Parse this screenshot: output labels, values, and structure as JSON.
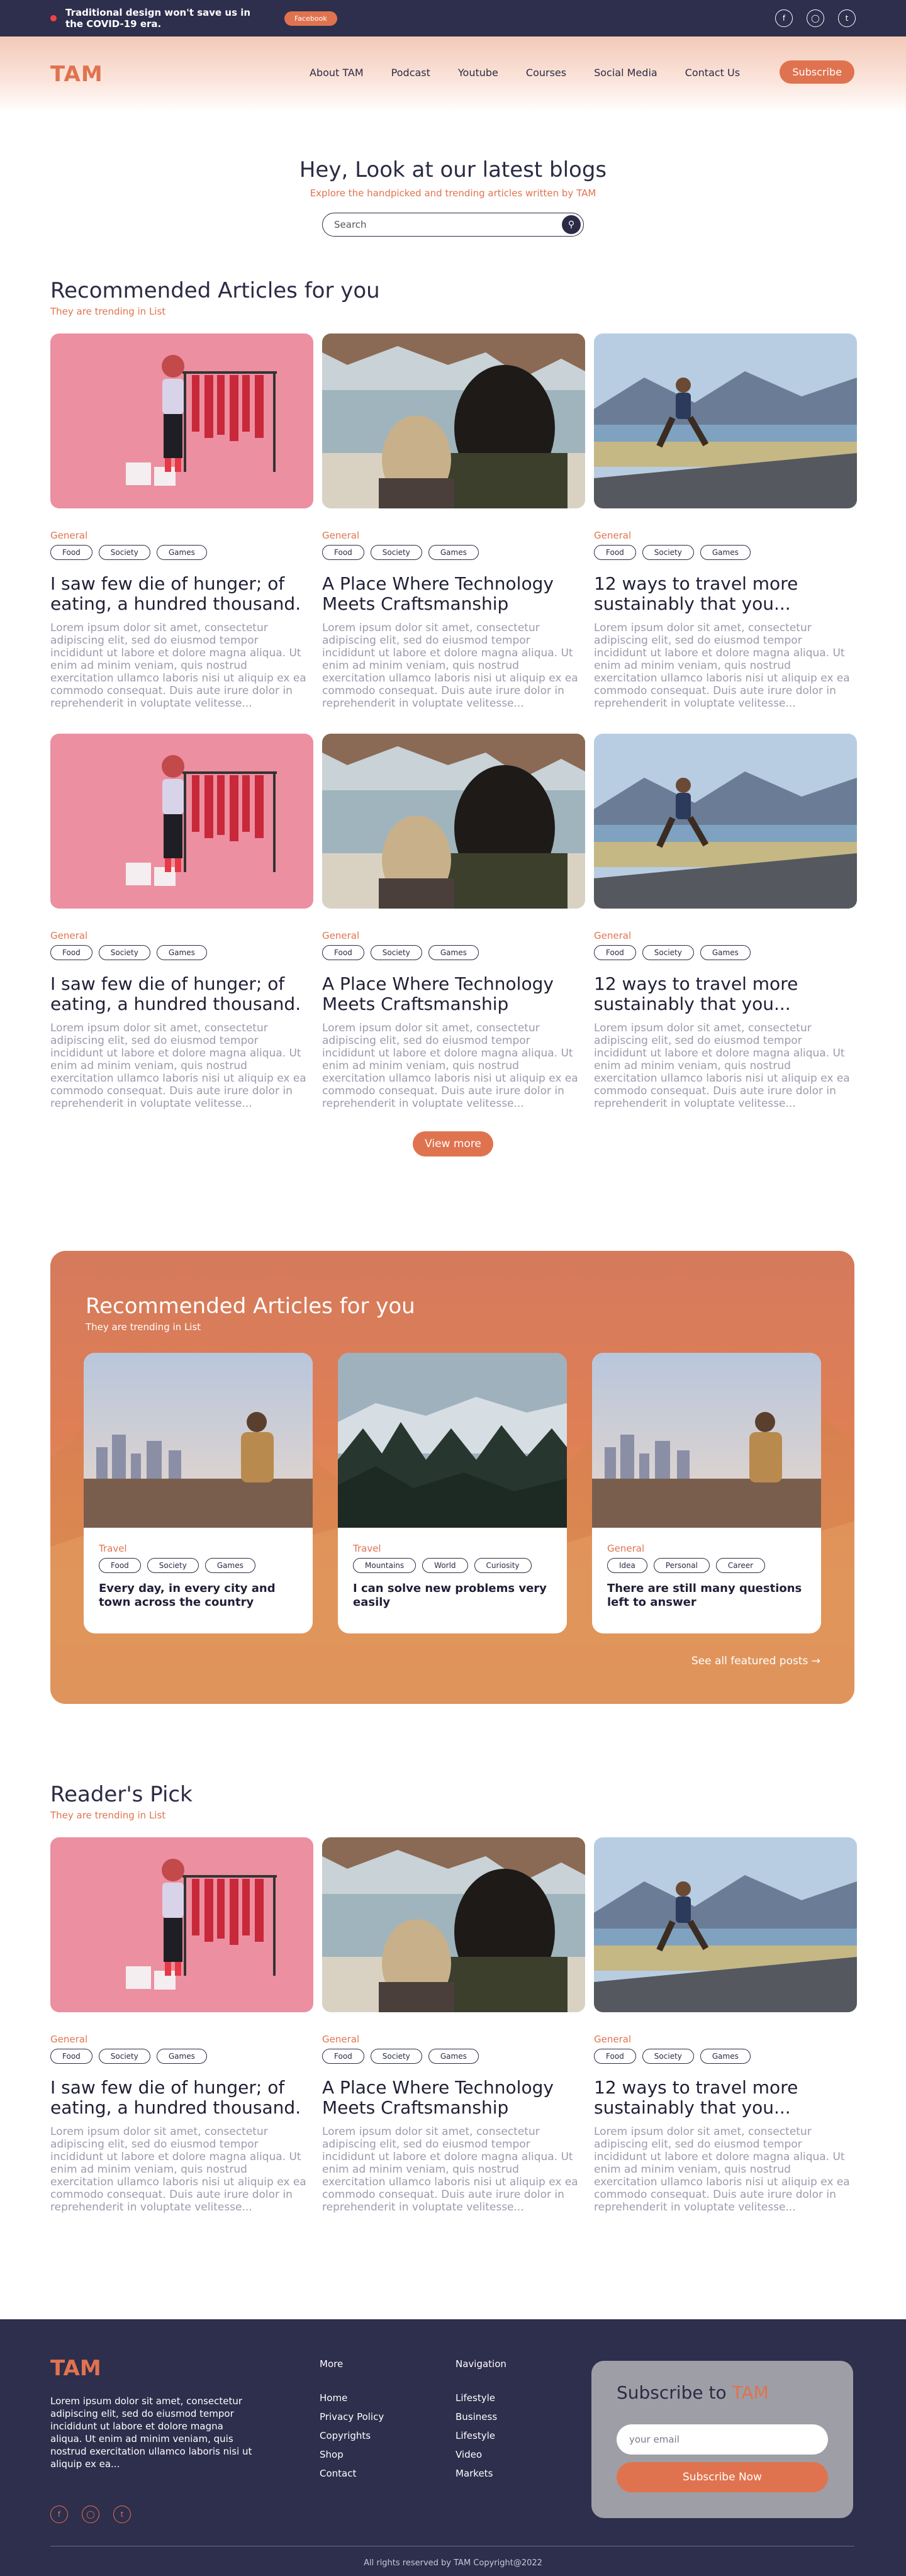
{
  "topbar": {
    "message": "Traditional design won't save us in the COVID-19 era.",
    "button_label": "Facebook",
    "socials": [
      "facebook-icon",
      "instagram-icon",
      "twitter-icon"
    ]
  },
  "header": {
    "logo": "TAM",
    "nav": [
      "About TAM",
      "Podcast",
      "Youtube",
      "Courses",
      "Social Media",
      "Contact Us"
    ],
    "subscribe_label": "Subscribe"
  },
  "hero": {
    "title": "Hey, Look at our latest blogs",
    "subtitle": "Explore the handpicked and trending articles written by TAM",
    "search_placeholder": "Search"
  },
  "recommended": {
    "title": "Recommended  Articles for you",
    "subtitle": "They are trending in List",
    "cards": [
      {
        "category": "General",
        "tags": [
          "Food",
          "Society",
          "Games"
        ],
        "title": "I saw few die of hunger; of eating, a hundred thousand.",
        "body": "Lorem ipsum dolor sit amet, consectetur adipiscing elit, sed do eiusmod tempor incididunt ut labore et dolore magna aliqua. Ut enim ad minim veniam, quis nostrud exercitation ullamco laboris nisi ut aliquip ex ea commodo consequat. Duis aute irure dolor in reprehenderit in voluptate velitesse..."
      },
      {
        "category": "General",
        "tags": [
          "Food",
          "Society",
          "Games"
        ],
        "title": "A Place Where Technology Meets Craftsmanship",
        "body": "Lorem ipsum dolor sit amet, consectetur adipiscing elit, sed do eiusmod tempor incididunt ut labore et dolore magna aliqua. Ut enim ad minim veniam, quis nostrud exercitation ullamco laboris nisi ut aliquip ex ea commodo consequat. Duis aute irure dolor in reprehenderit in voluptate velitesse..."
      },
      {
        "category": "General",
        "tags": [
          "Food",
          "Society",
          "Games"
        ],
        "title": "12 ways to travel more sustainably that you...",
        "body": "Lorem ipsum dolor sit amet, consectetur adipiscing elit, sed do eiusmod tempor incididunt ut labore et dolore magna aliqua. Ut enim ad minim veniam, quis nostrud exercitation ullamco laboris nisi ut aliquip ex ea commodo consequat. Duis aute irure dolor in reprehenderit in voluptate velitesse..."
      },
      {
        "category": "General",
        "tags": [
          "Food",
          "Society",
          "Games"
        ],
        "title": "I saw few die of hunger; of eating, a hundred thousand.",
        "body": "Lorem ipsum dolor sit amet, consectetur adipiscing elit, sed do eiusmod tempor incididunt ut labore et dolore magna aliqua. Ut enim ad minim veniam, quis nostrud exercitation ullamco laboris nisi ut aliquip ex ea commodo consequat. Duis aute irure dolor in reprehenderit in voluptate velitesse..."
      },
      {
        "category": "General",
        "tags": [
          "Food",
          "Society",
          "Games"
        ],
        "title": "A Place Where Technology Meets Craftsmanship",
        "body": "Lorem ipsum dolor sit amet, consectetur adipiscing elit, sed do eiusmod tempor incididunt ut labore et dolore magna aliqua. Ut enim ad minim veniam, quis nostrud exercitation ullamco laboris nisi ut aliquip ex ea commodo consequat. Duis aute irure dolor in reprehenderit in voluptate velitesse..."
      },
      {
        "category": "General",
        "tags": [
          "Food",
          "Society",
          "Games"
        ],
        "title": "12 ways to travel more sustainably that you...",
        "body": "Lorem ipsum dolor sit amet, consectetur adipiscing elit, sed do eiusmod tempor incididunt ut labore et dolore magna aliqua. Ut enim ad minim veniam, quis nostrud exercitation ullamco laboris nisi ut aliquip ex ea commodo consequat. Duis aute irure dolor in reprehenderit in voluptate velitesse..."
      }
    ],
    "view_more_label": "View more"
  },
  "featured": {
    "title": "Recommended  Articles for you",
    "subtitle": "They are trending in List",
    "cards": [
      {
        "category": "Travel",
        "tags": [
          "Food",
          "Society",
          "Games"
        ],
        "title": "Every day, in every city and town across the country"
      },
      {
        "category": "Travel",
        "tags": [
          "Mountains",
          "World",
          "Curiosity"
        ],
        "title": "I can solve new problems very easily"
      },
      {
        "category": "General",
        "tags": [
          "Idea",
          "Personal",
          "Career"
        ],
        "title": "There are still many questions left to answer"
      }
    ],
    "see_all_label": "See all featured posts →"
  },
  "readers_pick": {
    "title": "Reader's Pick",
    "subtitle": "They are trending in List",
    "cards": [
      {
        "category": "General",
        "tags": [
          "Food",
          "Society",
          "Games"
        ],
        "title": "I saw few die of hunger; of eating, a hundred thousand.",
        "body": "Lorem ipsum dolor sit amet, consectetur adipiscing elit, sed do eiusmod tempor incididunt ut labore et dolore magna aliqua. Ut enim ad minim veniam, quis nostrud exercitation ullamco laboris nisi ut aliquip ex ea commodo consequat. Duis aute irure dolor in reprehenderit in voluptate velitesse..."
      },
      {
        "category": "General",
        "tags": [
          "Food",
          "Society",
          "Games"
        ],
        "title": "A Place Where Technology Meets Craftsmanship",
        "body": "Lorem ipsum dolor sit amet, consectetur adipiscing elit, sed do eiusmod tempor incididunt ut labore et dolore magna aliqua. Ut enim ad minim veniam, quis nostrud exercitation ullamco laboris nisi ut aliquip ex ea commodo consequat. Duis aute irure dolor in reprehenderit in voluptate velitesse..."
      },
      {
        "category": "General",
        "tags": [
          "Food",
          "Society",
          "Games"
        ],
        "title": "12 ways to travel more sustainably that you...",
        "body": "Lorem ipsum dolor sit amet, consectetur adipiscing elit, sed do eiusmod tempor incididunt ut labore et dolore magna aliqua. Ut enim ad minim veniam, quis nostrud exercitation ullamco laboris nisi ut aliquip ex ea commodo consequat. Duis aute irure dolor in reprehenderit in voluptate velitesse..."
      }
    ]
  },
  "footer": {
    "logo": "TAM",
    "description": "Lorem ipsum dolor sit amet, consectetur adipiscing elit, sed do eiusmod tempor incididunt ut labore et dolore magna aliqua. Ut enim ad minim veniam, quis nostrud exercitation ullamco laboris nisi ut aliquip ex ea...",
    "more_title": "More",
    "more_links": [
      "Home",
      "Privacy Policy",
      "Copyrights",
      "Shop",
      "Contact"
    ],
    "nav_title": "Navigation",
    "nav_links": [
      "Lifestyle",
      "Business",
      "Lifestyle",
      "Video",
      "Markets"
    ],
    "subscribe_title": "Subscribe to ",
    "subscribe_brand": "TAM",
    "email_placeholder": "your email",
    "subscribe_button": "Subscribe Now",
    "copyright": "All rights reserved by TAM Copyright@2022"
  },
  "colors": {
    "accent": "#e0734f",
    "navy": "#2e2e4d"
  }
}
